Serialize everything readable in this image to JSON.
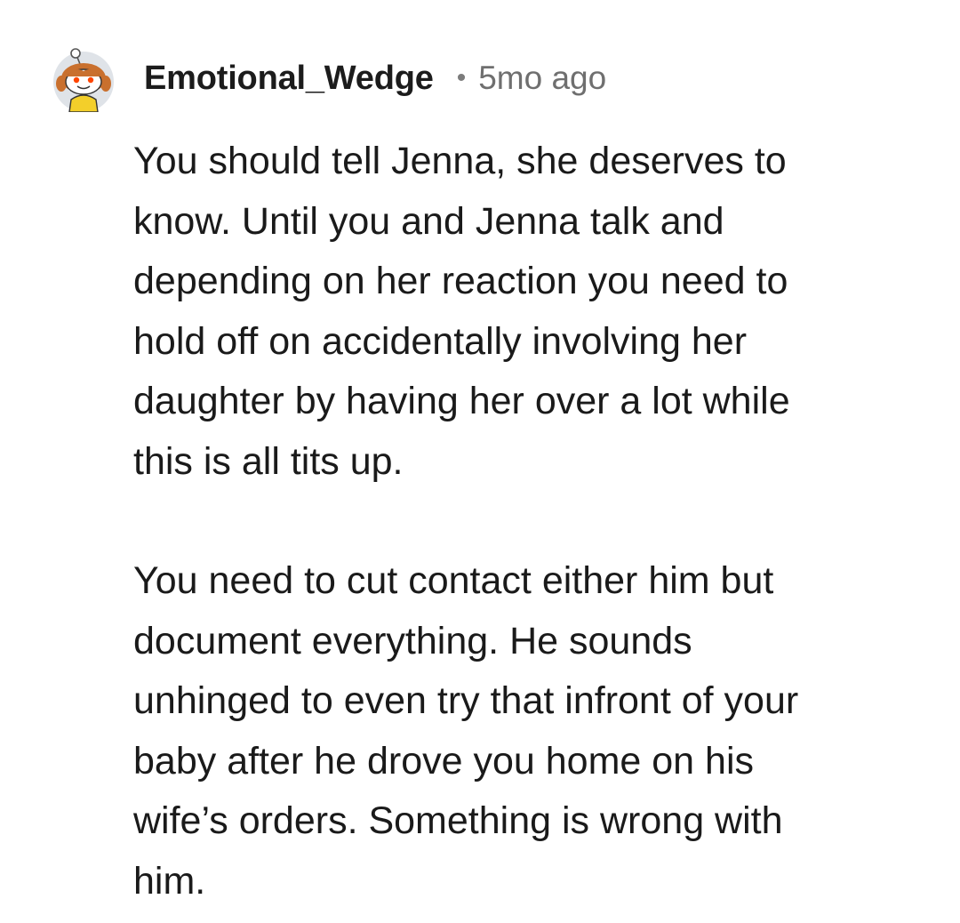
{
  "comment": {
    "author": "Emotional_Wedge",
    "separator": "•",
    "timestamp": "5mo ago",
    "avatar_icon": "reddit-snoo-avatar-icon",
    "paragraphs": [
      "You should tell Jenna, she deserves to\nknow. Until you and Jenna talk and\ndepending on her reaction you need to\nhold off on accidentally involving her\ndaughter by having her over a lot while\nthis is all tits up.",
      "You need to cut contact either him but\ndocument everything. He sounds\nunhinged to even try that infront of your\nbaby after he drove you home on his\nwife’s orders. Something is wrong with\nhim."
    ]
  },
  "colors": {
    "text": "#1a1a1a",
    "meta": "#6f6f6f",
    "avatar_bg": "#dfe3e8",
    "avatar_hair": "#c9702e",
    "avatar_shirt": "#f3cf2a",
    "avatar_eye": "#ff4500"
  }
}
